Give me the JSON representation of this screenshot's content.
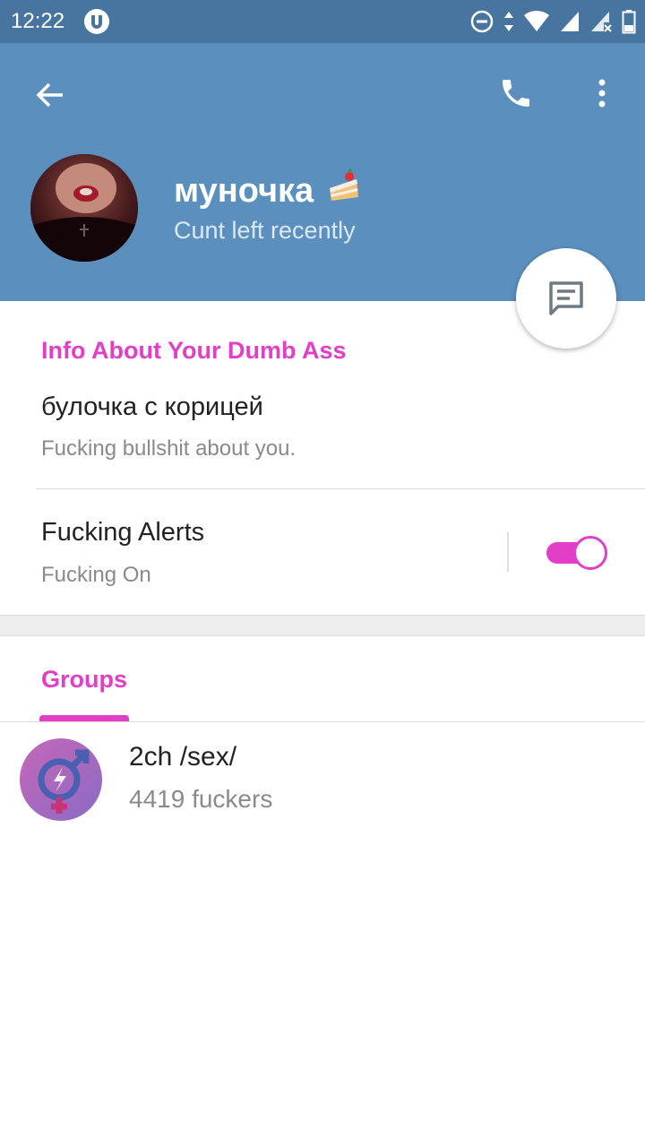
{
  "status_bar": {
    "time": "12:22",
    "app_icon": "utorrent-icon",
    "icons": [
      "do-not-disturb-icon",
      "data-arrows-icon",
      "wifi-icon",
      "signal-icon",
      "signal-no-sim-icon",
      "battery-icon"
    ]
  },
  "toolbar": {
    "back_icon": "arrow-back-icon",
    "call_icon": "phone-icon",
    "more_icon": "more-vert-icon"
  },
  "profile": {
    "name": "муночка",
    "emoji": "🍰",
    "status": "Cunt left recently",
    "avatar": "avatar-photo"
  },
  "fab": {
    "icon": "message-icon"
  },
  "info": {
    "section_title": "Info About Your Dumb Ass",
    "bio": "булочка с корицей",
    "bio_caption": "Fucking bullshit about you."
  },
  "alerts": {
    "title": "Fucking Alerts",
    "state": "Fucking On",
    "enabled": true
  },
  "groups": {
    "tab_label": "Groups",
    "items": [
      {
        "name": "2ch /sex/",
        "members": "4419 fuckers",
        "icon": "gender-symbol-icon"
      }
    ]
  },
  "colors": {
    "status_bar": "#4775a0",
    "header": "#5b8fbe",
    "accent": "#e23ec8"
  }
}
